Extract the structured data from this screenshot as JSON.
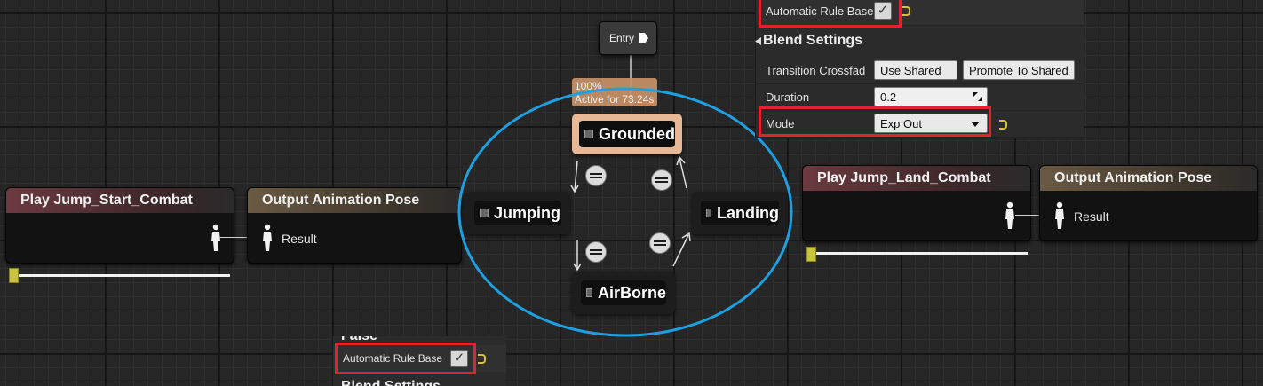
{
  "left_graph": {
    "player_node": {
      "title": "Play Jump_Start_Combat",
      "slider_value": 0.0
    },
    "output_node": {
      "title": "Output Animation Pose",
      "pin_label": "Result"
    }
  },
  "right_graph": {
    "player_node": {
      "title": "Play Jump_Land_Combat",
      "slider_value": 0.0
    },
    "output_node": {
      "title": "Output Animation Pose",
      "pin_label": "Result"
    }
  },
  "state_machine": {
    "entry_label": "Entry",
    "active_tooltip": {
      "weight": "100%",
      "status": "Active for 73.24s"
    },
    "states": {
      "grounded": "Grounded",
      "jumping": "Jumping",
      "landing": "Landing",
      "airborne": "AirBorne"
    },
    "highlight_color": "#1e9fe0"
  },
  "details_panel": {
    "auto_rule_label": "Automatic Rule Base",
    "auto_rule_checked": true,
    "section_title": "Blend Settings",
    "crossfade_label": "Transition Crossfad",
    "use_shared_label": "Use Shared",
    "promote_label": "Promote To Shared",
    "duration_label": "Duration",
    "duration_value": "0.2",
    "mode_label": "Mode",
    "mode_value": "Exp Out"
  },
  "bottom_panel": {
    "partial_header": "False",
    "auto_rule_label": "Automatic Rule Base",
    "auto_rule_checked": true,
    "partial_footer": "Blend Settings"
  },
  "colors": {
    "callout_red": "#e0232e",
    "reset_yellow": "#d4c03a"
  }
}
